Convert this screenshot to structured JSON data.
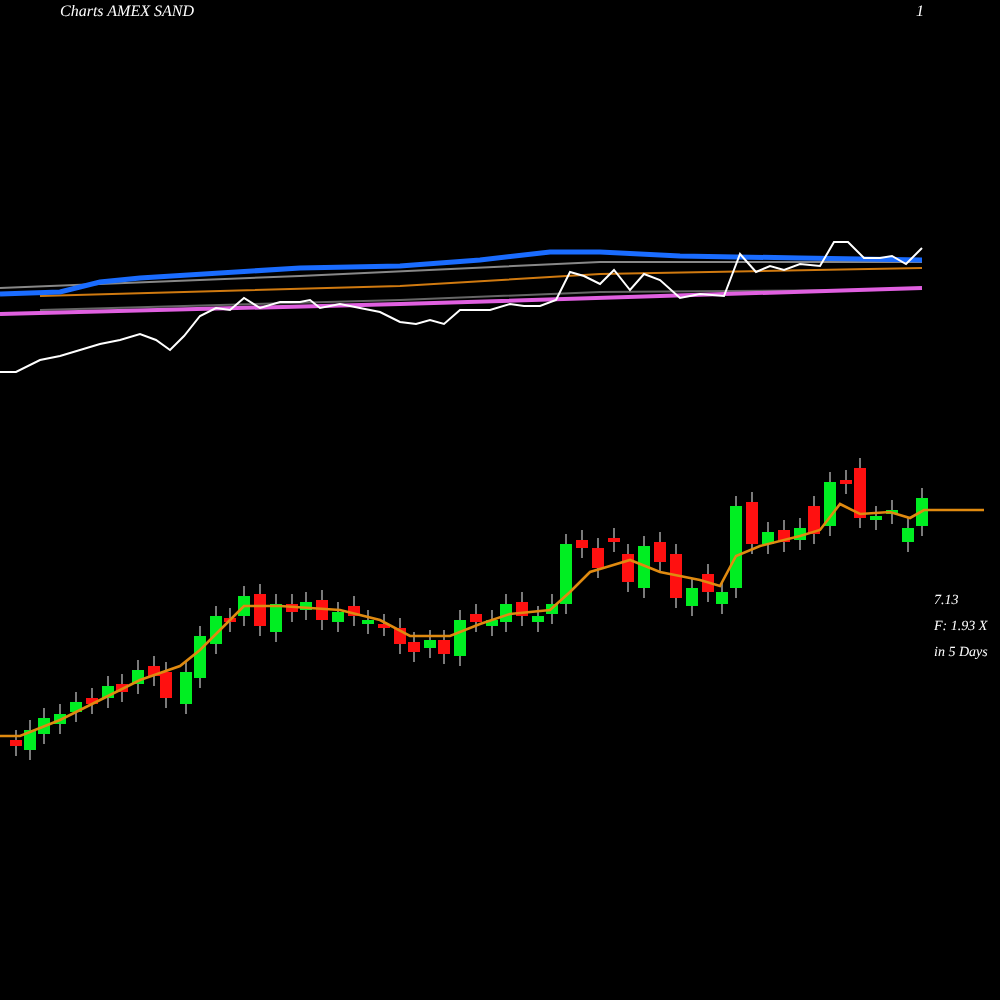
{
  "header": {
    "title": "Charts AMEX  SAND",
    "number": "1"
  },
  "labels": [
    {
      "text": "7.13"
    },
    {
      "text": "F: 1.93 X"
    },
    {
      "text": "in 5 Days"
    }
  ]
}
